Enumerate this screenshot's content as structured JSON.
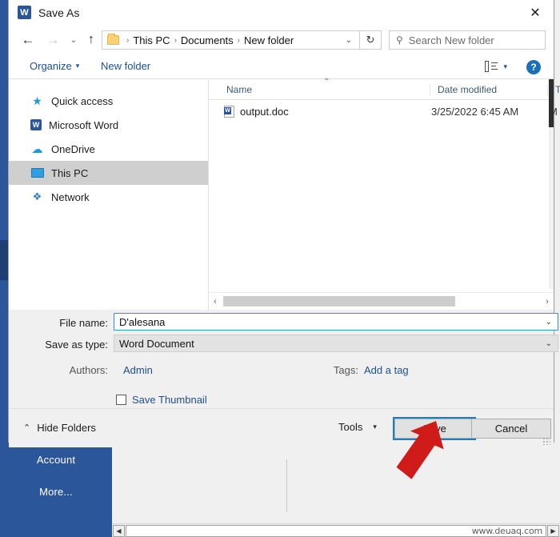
{
  "background": {
    "rail_items": [
      {
        "label": "Account"
      },
      {
        "label": "More..."
      }
    ],
    "watermark": "www.deuaq.com",
    "rail_color": "#2b579a"
  },
  "dialog": {
    "title": "Save As",
    "app_icon": "W",
    "close_icon": "✕",
    "nav": {
      "back_icon": "←",
      "forward_icon": "→",
      "recent_icon": "⌄",
      "up_icon": "↑",
      "refresh_icon": "↻",
      "breadcrumb": [
        {
          "label": "This PC"
        },
        {
          "label": "Documents"
        },
        {
          "label": "New folder"
        }
      ],
      "breadcrumb_separator": "›",
      "breadcrumb_caret": "⌄",
      "search_placeholder": "Search New folder",
      "search_icon": "⚲"
    },
    "commands": {
      "organize_label": "Organize",
      "organize_caret": "▾",
      "new_folder_label": "New folder",
      "view_caret": "▾",
      "help_label": "?"
    },
    "sidebar": {
      "items": [
        {
          "label": "Quick access",
          "icon": "star-icon",
          "glyph": "★",
          "selected": false
        },
        {
          "label": "Microsoft Word",
          "icon": "word-icon",
          "glyph": "W",
          "selected": false
        },
        {
          "label": "OneDrive",
          "icon": "cloud-icon",
          "glyph": "☁",
          "selected": false
        },
        {
          "label": "This PC",
          "icon": "computer-icon",
          "glyph": "",
          "selected": true
        },
        {
          "label": "Network",
          "icon": "network-icon",
          "glyph": "❖",
          "selected": false
        }
      ],
      "selection_color": "#cfcfcf"
    },
    "filelist": {
      "sort_caret": "⌃",
      "columns": [
        {
          "label": "Name"
        },
        {
          "label": "Date modified"
        },
        {
          "label": "Ty"
        }
      ],
      "rows": [
        {
          "name": "output.doc",
          "date_modified": "3/25/2022 6:45 AM",
          "type": "M"
        }
      ],
      "hscroll_left": "‹",
      "hscroll_right": "›"
    },
    "form": {
      "filename_label": "File name:",
      "filename_value": "D'alesana",
      "savetype_label": "Save as type:",
      "savetype_value": "Word Document",
      "combo_caret": "⌄",
      "authors_label": "Authors:",
      "authors_value": "Admin",
      "tags_label": "Tags:",
      "tags_value": "Add a tag",
      "thumbnail_label": "Save Thumbnail",
      "thumbnail_checked": false
    },
    "footer": {
      "hide_folders_label": "Hide Folders",
      "hide_folders_caret": "⌃",
      "tools_label": "Tools",
      "tools_caret": "▾",
      "save_label": "Save",
      "cancel_label": "Cancel",
      "focus_color": "#1a7fc1"
    }
  },
  "annotation": {
    "arrow_color": "#d01b1b",
    "points_at": "Save"
  }
}
